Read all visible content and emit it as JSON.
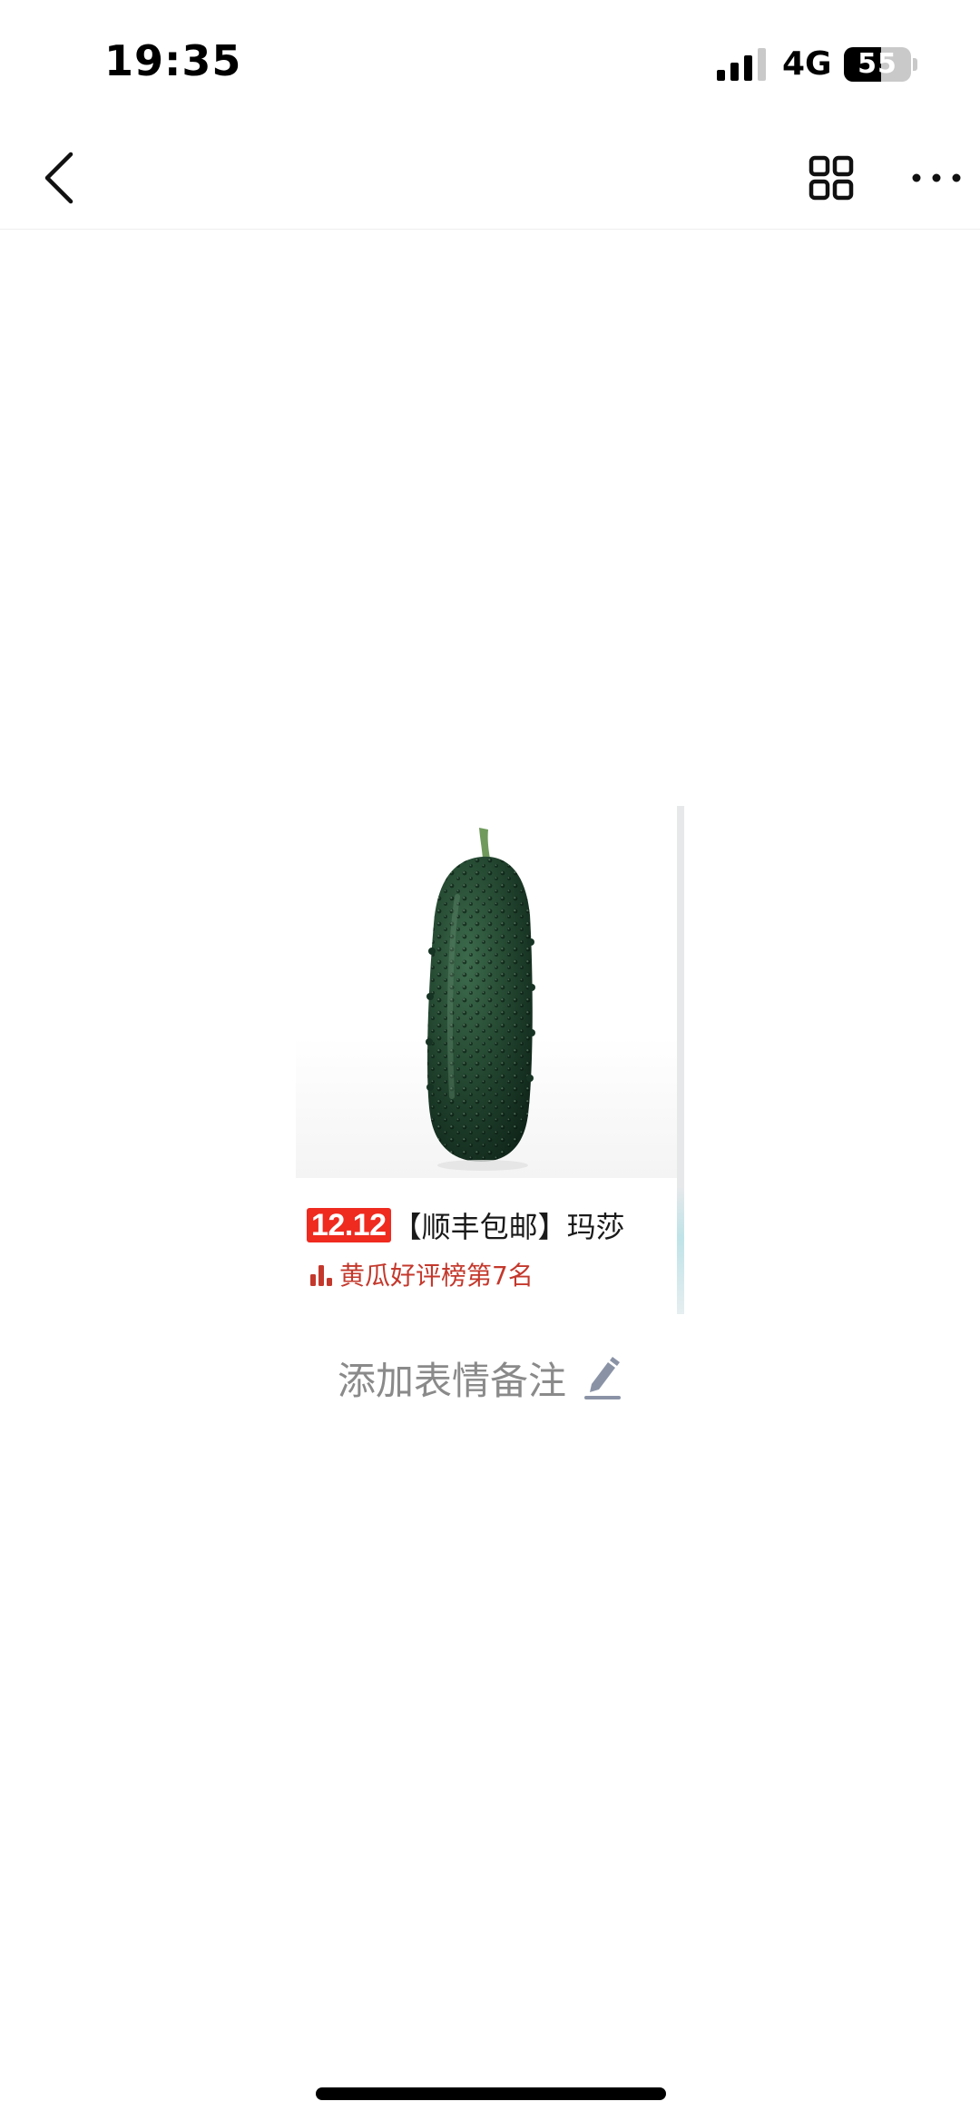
{
  "status_bar": {
    "time": "19:35",
    "network": "4G",
    "battery_level": "55",
    "battery_percent": 0.55
  },
  "nav": {
    "back_icon": "chevron-left-icon",
    "grid_icon": "grid-icon",
    "more_icon": "ellipsis-icon"
  },
  "product_card": {
    "image": "cucumber-image",
    "promo_badge": "12.12",
    "title": "【顺丰包邮】玛莎",
    "rank_icon": "bar-chart-icon",
    "rank_text": "黄瓜好评榜第7名",
    "colors": {
      "badge": "#ef2a1f",
      "rank": "#c4382c"
    }
  },
  "add_note": {
    "label": "添加表情备注",
    "icon": "pencil-icon"
  }
}
